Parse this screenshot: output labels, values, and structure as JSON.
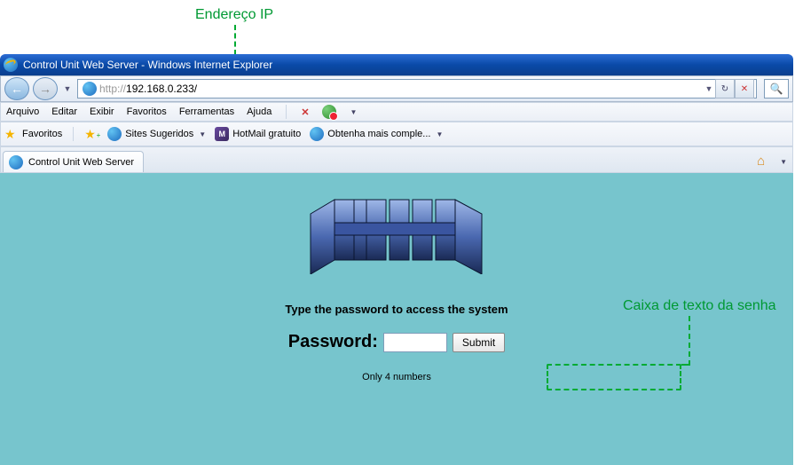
{
  "annotations": {
    "ip_label": "Endereço IP",
    "pw_label": "Caixa de texto da senha"
  },
  "window": {
    "title": "Control Unit Web Server - Windows Internet Explorer"
  },
  "address": {
    "url_grey_prefix": "http://",
    "url_host": "192.168.0.233/",
    "refresh_glyph": "↻",
    "stop_glyph": "✕",
    "search_glyph": "🔍"
  },
  "menu": {
    "items": [
      "Arquivo",
      "Editar",
      "Exibir",
      "Favoritos",
      "Ferramentas",
      "Ajuda"
    ]
  },
  "favorites": {
    "label": "Favoritos",
    "items": [
      {
        "label": "Sites Sugeridos",
        "has_dd": true
      },
      {
        "label": "HotMail gratuito",
        "has_dd": false
      },
      {
        "label": "Obtenha mais comple...",
        "has_dd": true
      }
    ]
  },
  "tab": {
    "title": "Control Unit Web Server"
  },
  "page": {
    "prompt": "Type the password to access the system",
    "password_label": "Password:",
    "submit_label": "Submit",
    "hint": "Only 4 numbers"
  }
}
